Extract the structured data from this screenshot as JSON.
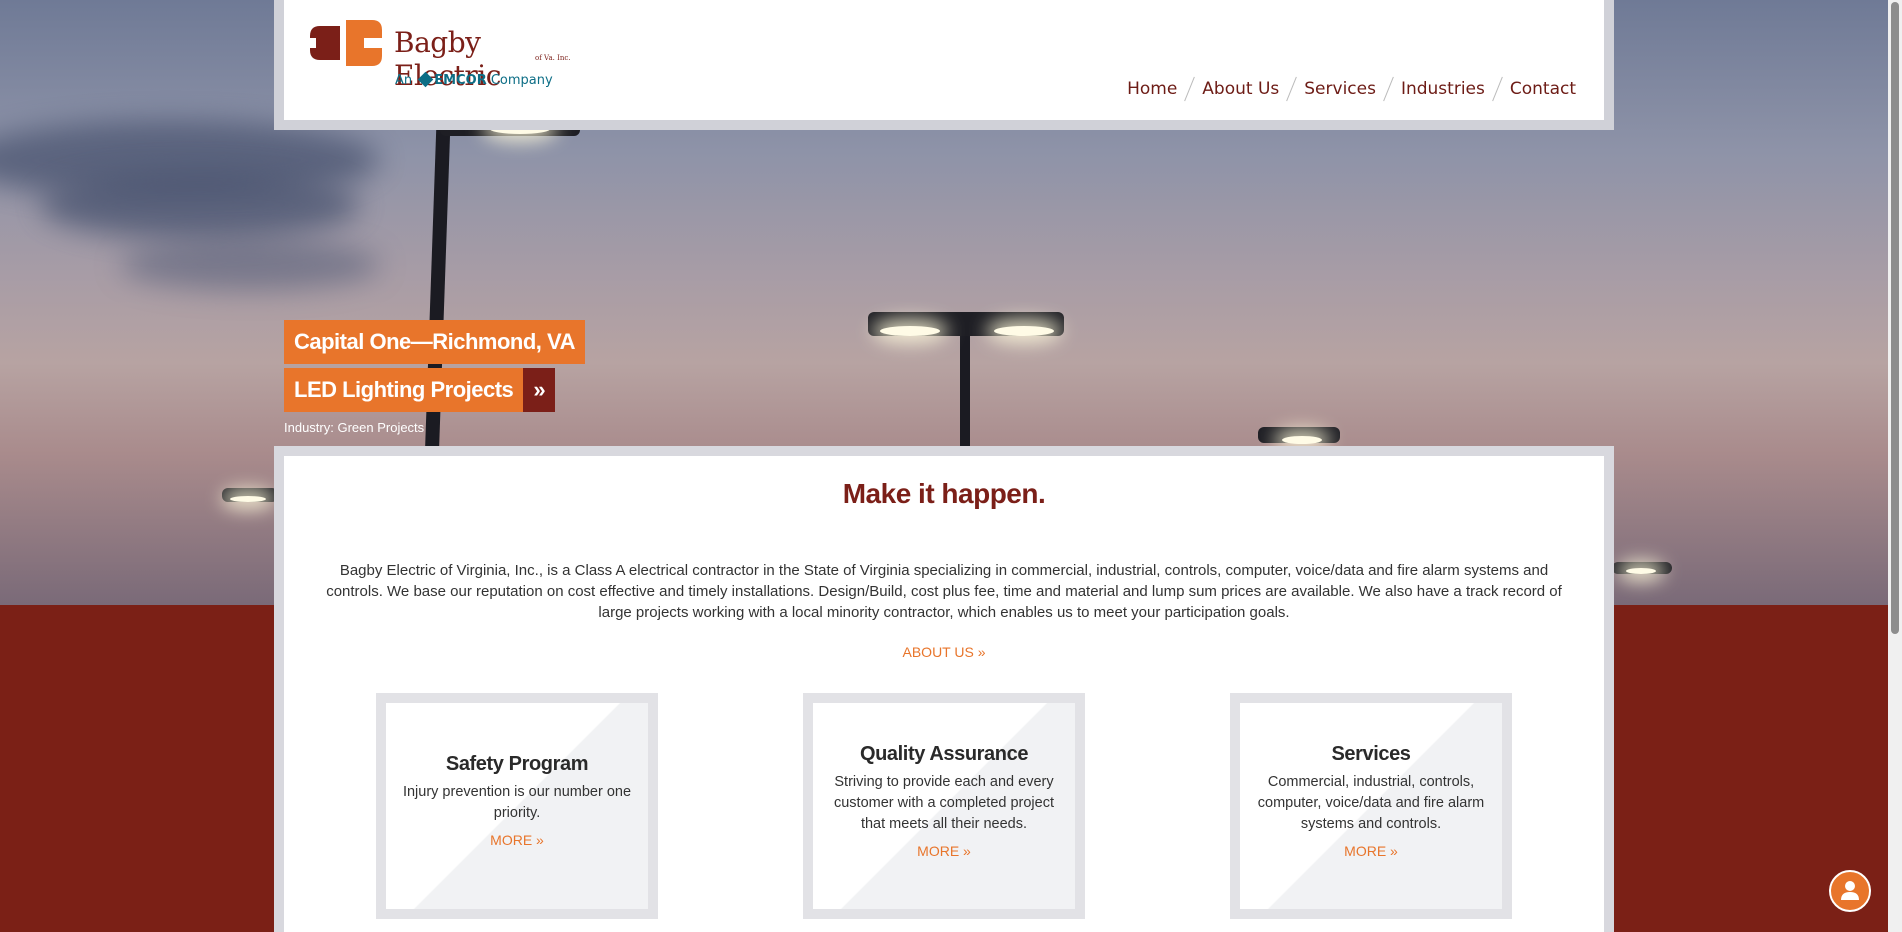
{
  "brand": {
    "name": "Bagby Electric",
    "sub": "of Va. Inc.",
    "emcor_prefix": "An",
    "emcor_name": "EMCOR",
    "emcor_suffix": "Company"
  },
  "nav": {
    "items": [
      "Home",
      "About Us",
      "Services",
      "Industries",
      "Contact"
    ]
  },
  "feature": {
    "title": "Capital One—Richmond, VA",
    "subtitle": "LED Lighting Projects",
    "arrow": "»",
    "industry": "Industry: Green Projects"
  },
  "main": {
    "headline": "Make it happen.",
    "intro": "Bagby Electric of Virginia, Inc., is a Class A electrical contractor in the State of Virginia specializing in commercial, industrial, controls, computer, voice/data and fire alarm systems and controls. We base our reputation on cost effective and timely installations. Design/Build, cost plus fee, time and material and lump sum prices are available. We also have a track record of large projects working with a local minority contractor, which enables us to meet your participation goals.",
    "about_link": "ABOUT US »"
  },
  "boxes": [
    {
      "title": "Safety Program",
      "text": "Injury prevention is our number one priority.",
      "more": "MORE »"
    },
    {
      "title": "Quality Assurance",
      "text": "Striving to provide each and every customer with a completed project that meets all their needs.",
      "more": "MORE »"
    },
    {
      "title": "Services",
      "text": "Commercial, industrial, controls, computer, voice/data and fire alarm systems and controls.",
      "more": "MORE »"
    }
  ],
  "colors": {
    "brand_red": "#7b1f18",
    "brand_orange": "#e8752b",
    "emcor_teal": "#0d6e86"
  },
  "icons": {
    "user_button": "user-icon"
  }
}
